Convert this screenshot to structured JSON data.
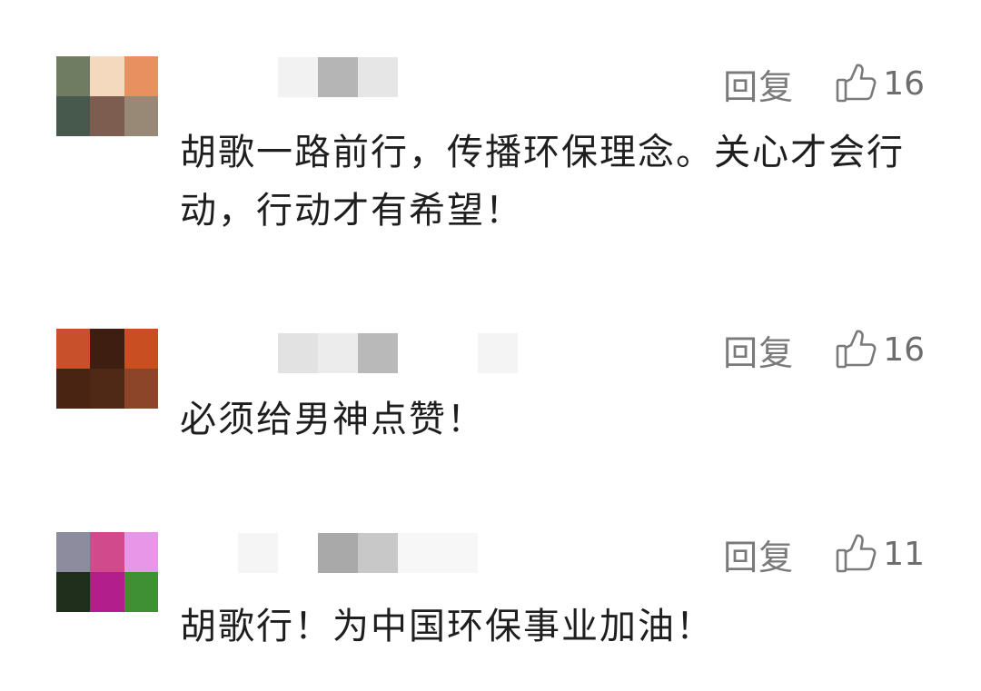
{
  "comments": [
    {
      "reply_label": "回复",
      "like_count": "16",
      "text": "胡歌一路前行，传播环保理念。关心才会行动，行动才有希望！",
      "avatar_colors": [
        "#6f7c62",
        "#f5d9bf",
        "#e8905f",
        "#47584c",
        "#7d5d4f",
        "#988876"
      ]
    },
    {
      "reply_label": "回复",
      "like_count": "16",
      "text": "必须给男神点赞！",
      "avatar_colors": [
        "#c8502a",
        "#3e1e10",
        "#c94f22",
        "#4a2413",
        "#4f2816",
        "#8c4528"
      ]
    },
    {
      "reply_label": "回复",
      "like_count": "11",
      "text": "胡歌行！为中国环保事业加油！",
      "avatar_colors": [
        "#8c8c9e",
        "#d04a8c",
        "#e897e8",
        "#1f2f1b",
        "#b21f8c",
        "#3f8f35"
      ]
    }
  ],
  "icons": {
    "like": "thumbs-up-icon"
  },
  "colors": {
    "text": "#1e1e1e",
    "muted": "#7a7a7a",
    "background": "#ffffff"
  }
}
